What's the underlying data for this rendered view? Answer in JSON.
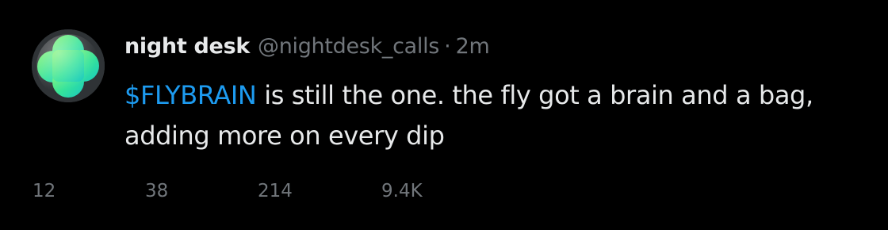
{
  "post": {
    "display_name": "night desk",
    "handle": "@nightdesk_calls",
    "separator": "·",
    "time": "2m",
    "cashtag": "$FLYBRAIN",
    "text_after_cashtag": " is still the one. the fly got a brain and a bag, adding more on every dip"
  },
  "avatar": {
    "icon": "green-clover-blob-icon",
    "colors": [
      "#7df36a",
      "#35e39a",
      "#18c9c0"
    ]
  },
  "actions": {
    "replies": "12",
    "reposts": "38",
    "likes": "214",
    "views": "9.4K"
  },
  "colors": {
    "background": "#000000",
    "text_primary": "#e7e9ea",
    "text_secondary": "#71767b",
    "link": "#1d9bf0"
  }
}
